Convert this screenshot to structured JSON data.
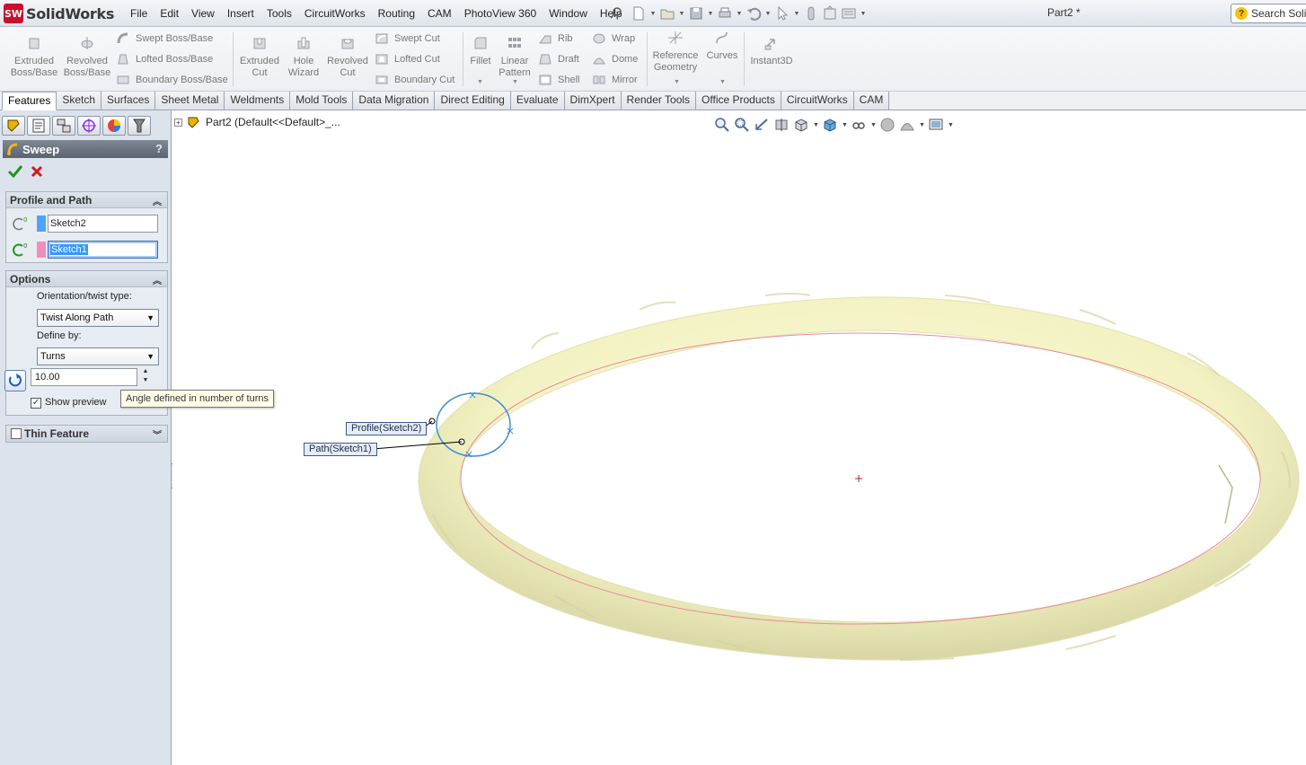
{
  "app": {
    "brand": "SolidWorks",
    "logo_mark": "SW",
    "menus": [
      "File",
      "Edit",
      "View",
      "Insert",
      "Tools",
      "CircuitWorks",
      "Routing",
      "CAM",
      "PhotoView 360",
      "Window",
      "Help"
    ],
    "doc_title": "Part2 *",
    "search_placeholder": "Search Solid"
  },
  "ribbon": {
    "extruded_boss": [
      "Extruded",
      "Boss/Base"
    ],
    "revolved_boss": [
      "Revolved",
      "Boss/Base"
    ],
    "swept_boss": "Swept Boss/Base",
    "lofted_boss": "Lofted Boss/Base",
    "boundary_boss": "Boundary Boss/Base",
    "extruded_cut": [
      "Extruded",
      "Cut"
    ],
    "hole_wizard": [
      "Hole",
      "Wizard"
    ],
    "revolved_cut": [
      "Revolved",
      "Cut"
    ],
    "swept_cut": "Swept Cut",
    "lofted_cut": "Lofted Cut",
    "boundary_cut": "Boundary Cut",
    "fillet": "Fillet",
    "linear_pattern": [
      "Linear",
      "Pattern"
    ],
    "rib": "Rib",
    "draft": "Draft",
    "shell": "Shell",
    "wrap": "Wrap",
    "dome": "Dome",
    "mirror": "Mirror",
    "reference_geometry": [
      "Reference",
      "Geometry"
    ],
    "curves": "Curves",
    "instant3d": "Instant3D"
  },
  "tabs": [
    "Features",
    "Sketch",
    "Surfaces",
    "Sheet Metal",
    "Weldments",
    "Mold Tools",
    "Data Migration",
    "Direct Editing",
    "Evaluate",
    "DimXpert",
    "Render Tools",
    "Office Products",
    "CircuitWorks",
    "CAM"
  ],
  "active_tab": "Features",
  "property_manager": {
    "title": "Sweep",
    "help": "?",
    "profile_and_path": {
      "header": "Profile and Path",
      "profile_value": "Sketch2",
      "path_value": "Sketch1",
      "profile_color": "#4da3ff",
      "path_color": "#f28cc0"
    },
    "options": {
      "header": "Options",
      "orientation_label": "Orientation/twist type:",
      "orientation_value": "Twist Along Path",
      "define_by_label": "Define by:",
      "define_by_value": "Turns",
      "turns_value": "10.00",
      "show_preview_label": "Show preview",
      "show_preview_checked": true
    },
    "thin_feature": {
      "header": "Thin Feature",
      "checked": false
    }
  },
  "tooltip": "Angle defined in number of turns",
  "tree": {
    "root_label": "Part2  (Default<<Default>_..."
  },
  "viewport": {
    "callout_profile": "Profile(Sketch2)",
    "callout_path": "Path(Sketch1)",
    "part_color": "#f6f5c6",
    "path_color": "#e88a9a",
    "profile_color": "#3a8fd8"
  }
}
